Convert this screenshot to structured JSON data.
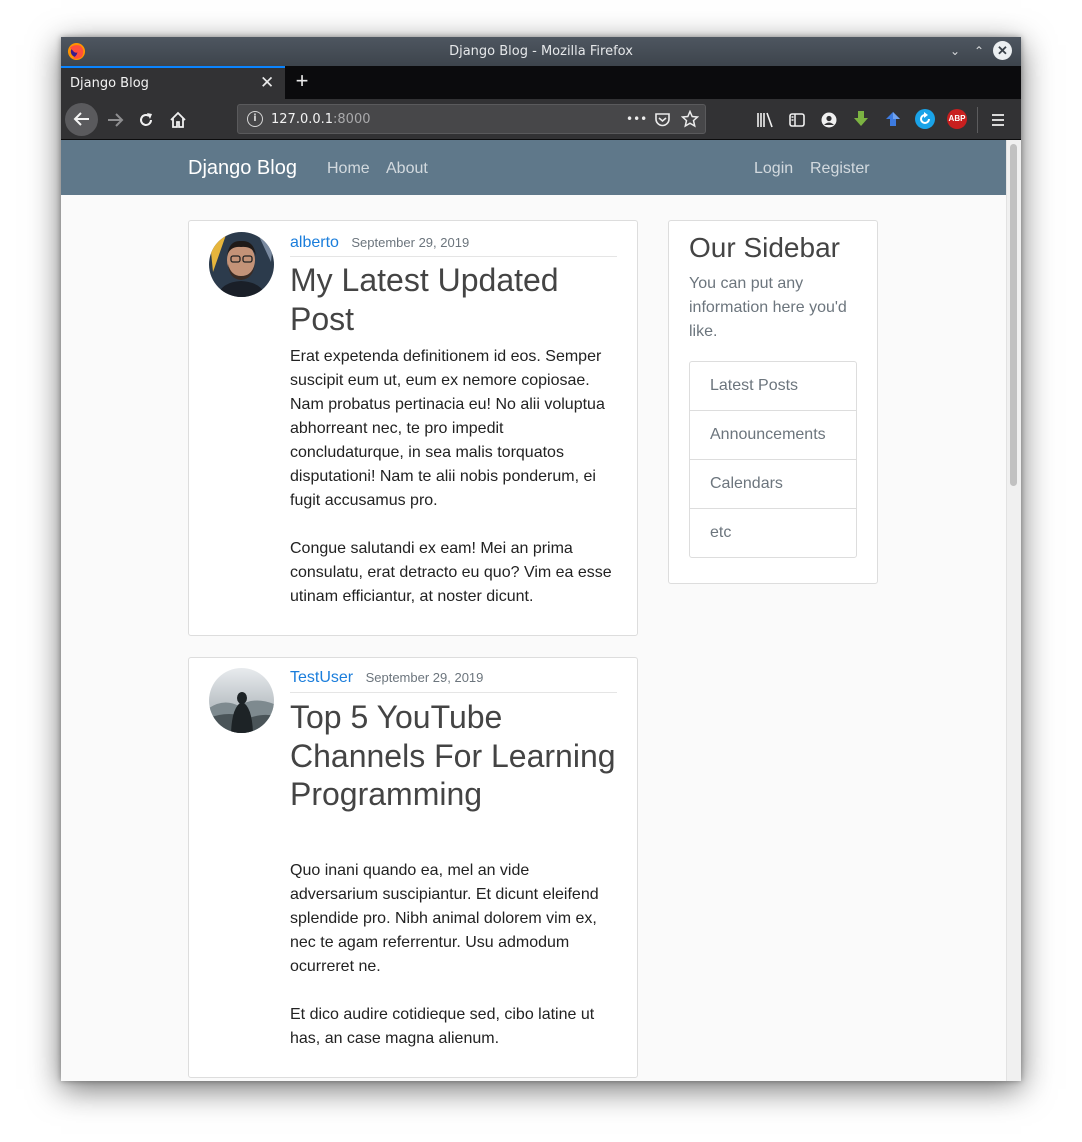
{
  "window": {
    "title": "Django Blog - Mozilla Firefox",
    "controls": {
      "minimize": "⌄",
      "maximize": "⌃",
      "close": "✕"
    }
  },
  "tabs": [
    {
      "label": "Django Blog",
      "close": "✕"
    }
  ],
  "new_tab": "+",
  "toolbar": {
    "url_host": "127.0.0.1",
    "url_port": ":8000",
    "page_actions": "•••",
    "extensions": [
      {
        "name": "library-icon"
      },
      {
        "name": "sidebar-icon"
      },
      {
        "name": "account-icon"
      },
      {
        "name": "download-extension-icon",
        "color": "#7cb342"
      },
      {
        "name": "upload-extension-icon",
        "color": "#3d7be0"
      },
      {
        "name": "sync-extension-icon",
        "color": "#1aa3e8"
      },
      {
        "name": "adblock-extension-icon",
        "label": "ABP",
        "color": "#c81f1f"
      }
    ]
  },
  "site": {
    "brand": "Django Blog",
    "nav_left": [
      "Home",
      "About"
    ],
    "nav_right": [
      "Login",
      "Register"
    ],
    "nav_color": "#5f788a",
    "link_color": "#1a7ddb"
  },
  "posts": [
    {
      "author": "alberto",
      "date": "September 29, 2019",
      "title": "My Latest Updated Post",
      "paragraphs": [
        "Erat expetenda definitionem id eos. Semper suscipit eum ut, eum ex nemore copiosae. Nam probatus pertinacia eu! No alii voluptua abhorreant nec, te pro impedit concludaturque, in sea malis torquatos disputationi! Nam te alii nobis ponderum, ei fugit accusamus pro.",
        "Congue salutandi ex eam! Mei an prima consulatu, erat detracto eu quo? Vim ea esse utinam efficiantur, at noster dicunt."
      ]
    },
    {
      "author": "TestUser",
      "date": "September 29, 2019",
      "title": "Top 5 YouTube Channels For Learning Programming",
      "paragraphs": [
        "Quo inani quando ea, mel an vide adversarium suscipiantur. Et dicunt eleifend splendide pro. Nibh animal dolorem vim ex, nec te agam referrentur. Usu admodum ocurreret ne.",
        "Et dico audire cotidieque sed, cibo latine ut has, an case magna alienum."
      ]
    }
  ],
  "sidebar": {
    "title": "Our Sidebar",
    "text": "You can put any information here you'd like.",
    "items": [
      "Latest Posts",
      "Announcements",
      "Calendars",
      "etc"
    ]
  }
}
